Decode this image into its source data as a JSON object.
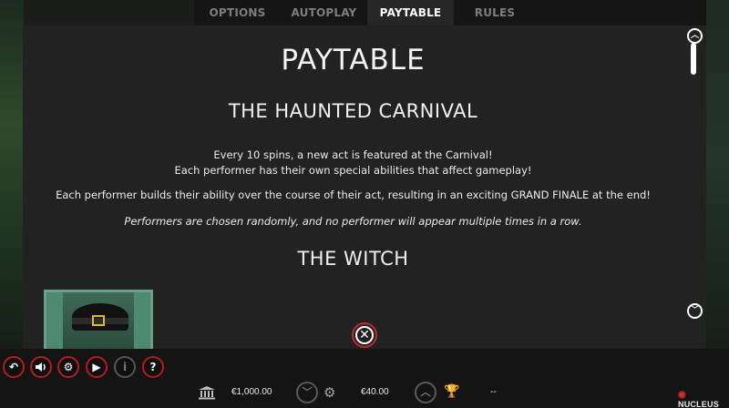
{
  "tabs": [
    {
      "label": "OPTIONS",
      "active": false
    },
    {
      "label": "AUTOPLAY",
      "active": false
    },
    {
      "label": "PAYTABLE",
      "active": true
    },
    {
      "label": "RULES",
      "active": false
    }
  ],
  "content": {
    "title": "PAYTABLE",
    "section1_heading": "THE HAUNTED CARNIVAL",
    "para1_line1": "Every 10 spins, a new act is featured at the Carnival!",
    "para1_line2": "Each performer has their own special abilities that affect gameplay!",
    "para2": "Each performer builds their ability over the course of their act, resulting in an exciting GRAND FINALE at the end!",
    "para3": "Performers are chosen randomly, and no performer will appear multiple times in a row.",
    "section2_heading": "THE WITCH"
  },
  "scroll": {
    "up_icon": "chevron-up-icon",
    "down_icon": "chevron-down-icon"
  },
  "close": {
    "icon": "close-icon",
    "glyph": "✕"
  },
  "controls": [
    {
      "name": "back-button",
      "icon": "back-arrow-icon",
      "glyph": "↶",
      "enabled": true
    },
    {
      "name": "sound-button",
      "icon": "speaker-icon",
      "glyph": "🔈",
      "enabled": true
    },
    {
      "name": "settings-button",
      "icon": "gear-icon",
      "glyph": "⚙",
      "enabled": true
    },
    {
      "name": "play-button",
      "icon": "play-icon",
      "glyph": "▶",
      "enabled": true
    },
    {
      "name": "info-button",
      "icon": "info-icon",
      "glyph": "i",
      "enabled": false
    },
    {
      "name": "help-button",
      "icon": "question-icon",
      "glyph": "?",
      "enabled": true
    }
  ],
  "status": {
    "balance": "€1,000.00",
    "bet": "€40.00",
    "win": "--"
  },
  "brand": {
    "name": "NUCLEUS"
  },
  "colors": {
    "accent_red": "#c62828",
    "panel": "#222222",
    "active_tab": "#262626"
  }
}
